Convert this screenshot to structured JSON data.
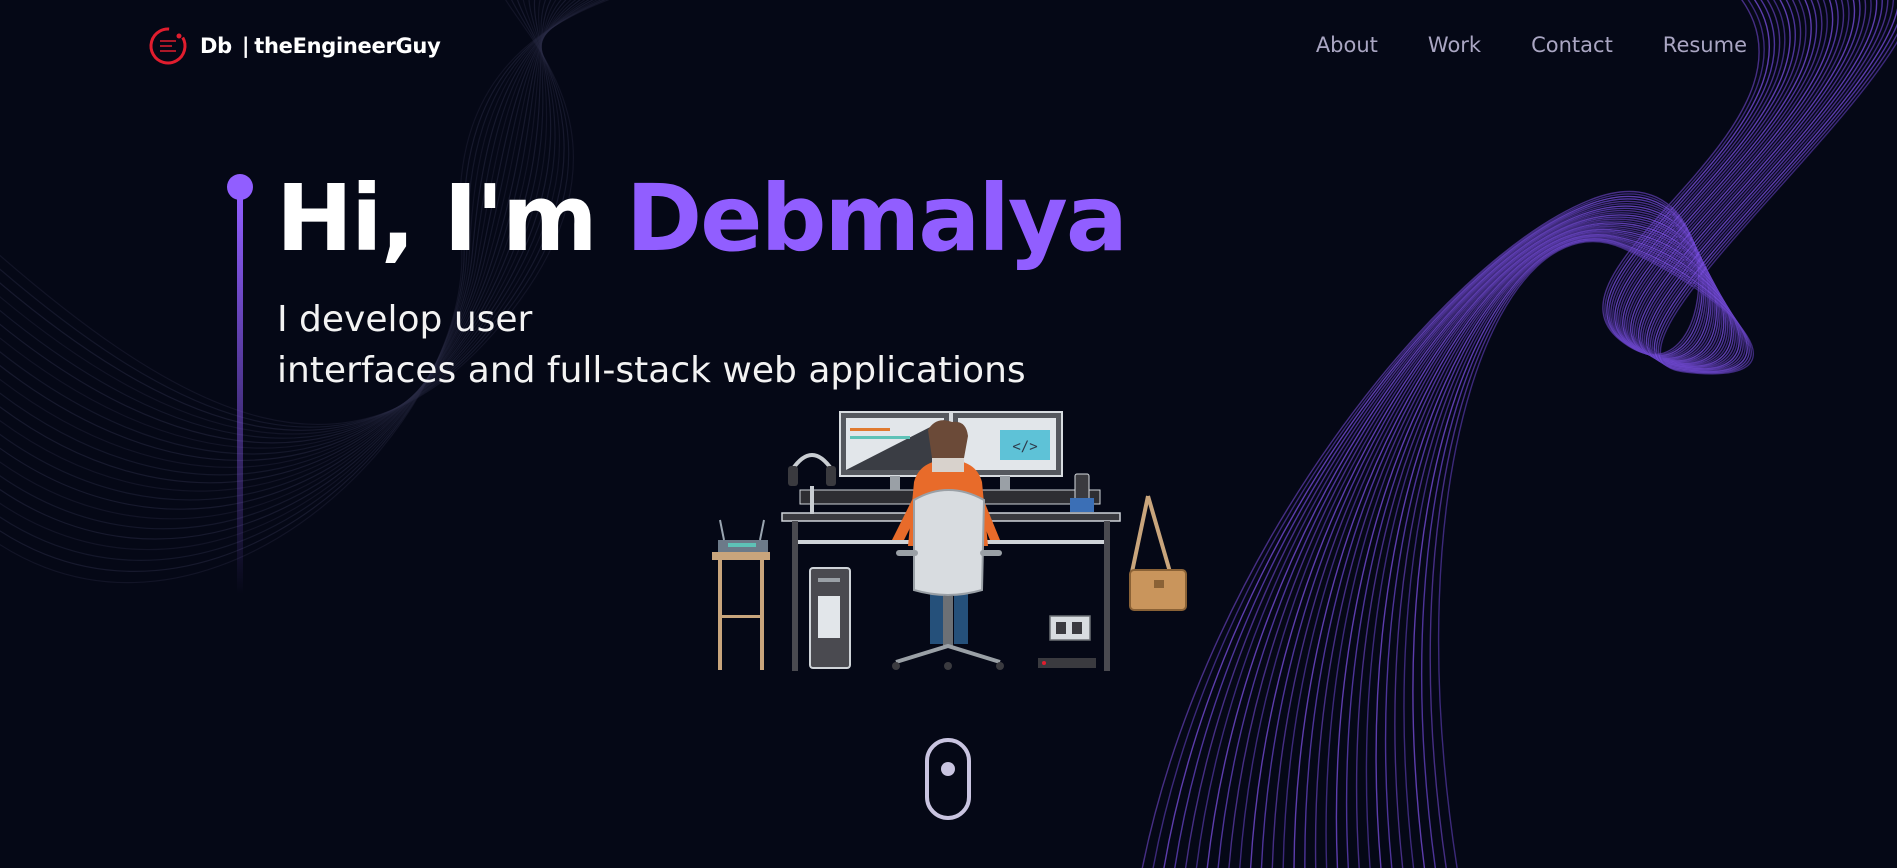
{
  "brand": {
    "initials": "Db",
    "separator": "|",
    "name": "theEngineerGuy",
    "logo_color": "#e11d2e"
  },
  "nav": {
    "items": [
      {
        "label": "About"
      },
      {
        "label": "Work"
      },
      {
        "label": "Contact"
      },
      {
        "label": "Resume"
      }
    ]
  },
  "hero": {
    "greeting": "Hi, I'm ",
    "name": "Debmalya",
    "subtitle_line1": "I develop user",
    "subtitle_line2": "interfaces and full-stack web applications",
    "accent_color": "#915eff",
    "illustration": "developer-at-desk-illustration"
  },
  "colors": {
    "background": "#050816",
    "nav_text": "#aaa6c3",
    "heading_text": "#ffffff",
    "wave_purple": "#7b4fe0"
  },
  "scroll": {
    "icon": "mouse-scroll-icon"
  }
}
